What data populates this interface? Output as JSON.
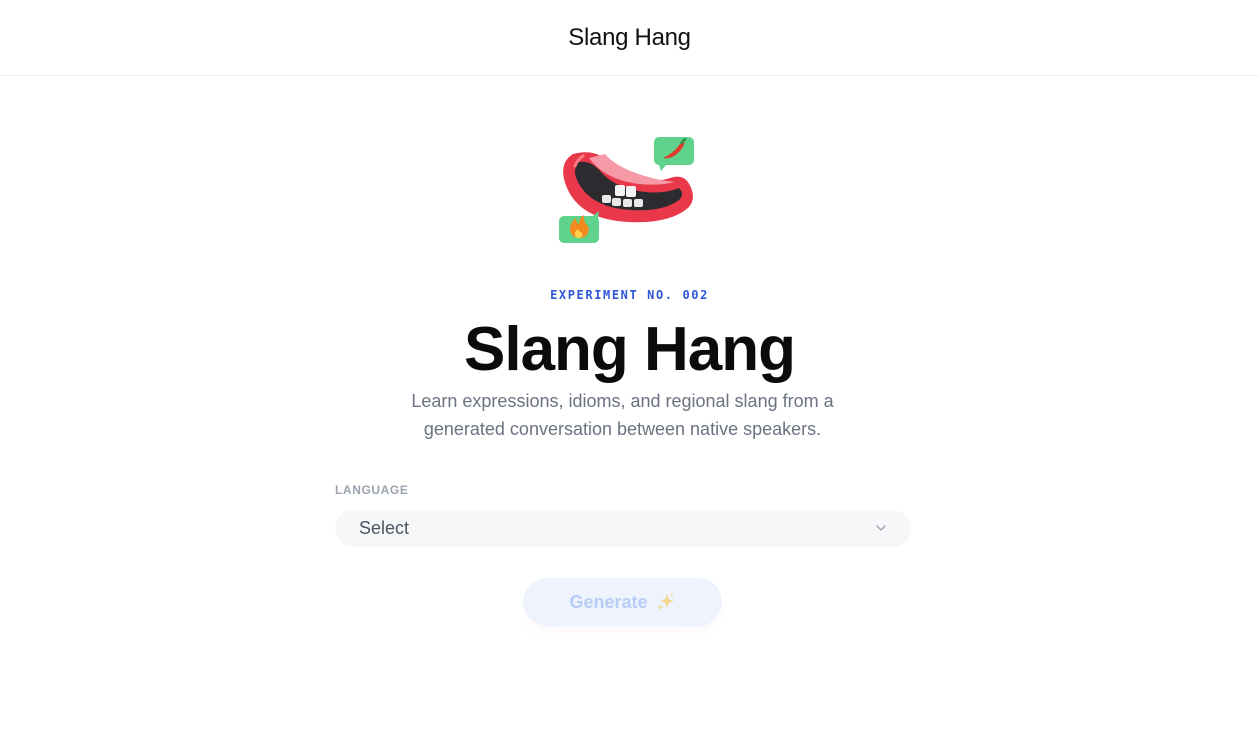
{
  "header": {
    "title": "Slang Hang"
  },
  "hero": {
    "illustration": "mouth-with-chili-and-fire-bubbles-icon",
    "eyebrow": "EXPERIMENT NO. 002",
    "title": "Slang Hang",
    "subtitle": "Learn expressions, idioms, and regional slang from a generated conversation between native speakers."
  },
  "form": {
    "language_label": "LANGUAGE",
    "language_select": {
      "value": "Select",
      "icon": "chevron-down-icon"
    },
    "generate_button": {
      "label": "Generate",
      "icon": "sparkles-icon",
      "enabled": false
    }
  },
  "colors": {
    "accent": "#2f56d8",
    "button_bg_disabled": "#eef3fd",
    "button_text_disabled": "#b7cdf5",
    "mouth_red": "#e8384a",
    "bubble_green": "#5fd28c"
  }
}
